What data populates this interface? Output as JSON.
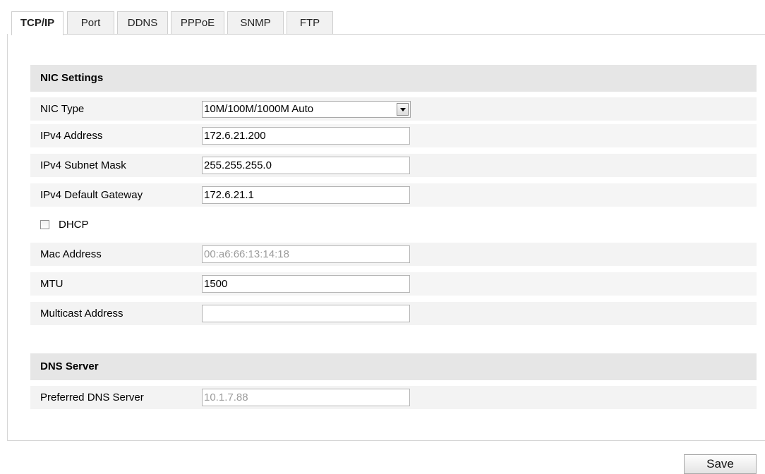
{
  "tabs": [
    {
      "label": "TCP/IP",
      "active": true
    },
    {
      "label": "Port"
    },
    {
      "label": "DDNS"
    },
    {
      "label": "PPPoE"
    },
    {
      "label": "SNMP"
    },
    {
      "label": "FTP"
    }
  ],
  "nic": {
    "section_title": "NIC Settings",
    "nic_type_label": "NIC Type",
    "nic_type_value": "10M/100M/1000M Auto",
    "ipv4_address_label": "IPv4 Address",
    "ipv4_address_value": "172.6.21.200",
    "subnet_label": "IPv4 Subnet Mask",
    "subnet_value": "255.255.255.0",
    "gateway_label": "IPv4 Default Gateway",
    "gateway_value": "172.6.21.1",
    "dhcp_label": "DHCP",
    "dhcp_checked": false,
    "mac_label": "Mac Address",
    "mac_value": "00:a6:66:13:14:18",
    "mtu_label": "MTU",
    "mtu_value": "1500",
    "multicast_label": "Multicast Address",
    "multicast_value": ""
  },
  "dns": {
    "section_title": "DNS Server",
    "preferred_label": "Preferred DNS Server",
    "preferred_value": "10.1.7.88"
  },
  "save_label": "Save"
}
